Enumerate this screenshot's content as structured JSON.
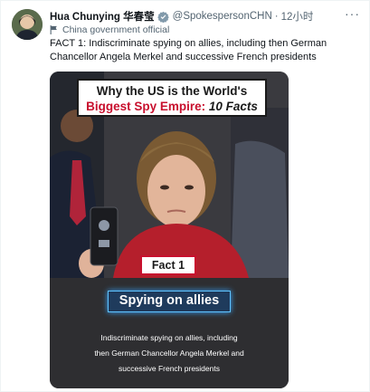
{
  "tweet": {
    "display_name": "Hua Chunying 华春莹",
    "handle": "@SpokespersonCHN",
    "separator": "·",
    "time": "12小时",
    "more_icon": "more-icon",
    "affiliation": "China government official",
    "text": "FACT 1: Indiscriminate spying on allies, including then German Chancellor Angela Merkel and successive French presidents",
    "colors": {
      "verified": "#829aab",
      "text": "#0f1419",
      "muted": "#536471"
    }
  },
  "media": {
    "title_line1": "Why the US is the World's",
    "title_line2_red": "Biggest Spy Empire:",
    "title_line2_dark": "10 Facts",
    "fact_label": "Fact 1",
    "spy_heading": "Spying on allies",
    "description_lines": [
      "Indiscriminate spying on allies, including",
      "then German Chancellor Angela Merkel and",
      "successive French presidents"
    ],
    "colors": {
      "red": "#c8102e",
      "glow": "#5fc3ff",
      "panel": "#2e2e31"
    }
  }
}
